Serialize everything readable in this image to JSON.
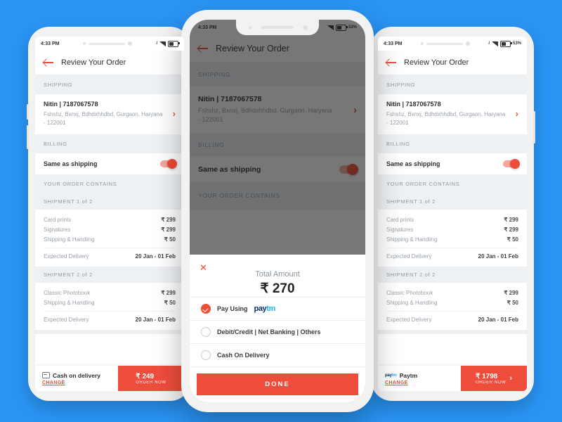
{
  "background_color": "#2a95f5",
  "accent_color": "#ef4d3c",
  "status_bar": {
    "time": "4:33 PM",
    "battery": "53%"
  },
  "header": {
    "title": "Review Your Order",
    "back_icon": "back-arrow-icon"
  },
  "sections": {
    "shipping_label": "SHIPPING",
    "billing_label": "BILLING",
    "order_label": "YOUR ORDER CONTAINS"
  },
  "address": {
    "name_phone": "Nitin | 7187067578",
    "line1": "Fshshz, Bxnxj, Bdhdxhhdbd, Gurgaon, Haryana",
    "line2": "- 122001",
    "chevron": "›"
  },
  "billing": {
    "same_as_shipping_label": "Same as shipping",
    "toggle_on": true
  },
  "shipments": [
    {
      "title": "SHIPMENT 1 of 2",
      "items": [
        {
          "name": "Card prints",
          "price": "₹ 299"
        },
        {
          "name": "Signatures",
          "price": "₹ 299"
        },
        {
          "name": "Shipping & Handling",
          "price": "₹ 50"
        }
      ],
      "delivery_label": "Expected Delivery",
      "delivery_value": "20 Jan - 01 Feb"
    },
    {
      "title": "SHIPMENT 2 of 2",
      "items": [
        {
          "name": "Classic Photobook",
          "price": "₹ 299"
        },
        {
          "name": "Shipping & Handling",
          "price": "₹ 50"
        }
      ],
      "delivery_label": "Expected Delivery",
      "delivery_value": "20 Jan - 01 Feb"
    }
  ],
  "bottom_bar_cod": {
    "method": "Cash on delivery",
    "method_icon": "wallet-icon",
    "change_label": "CHANGE",
    "amount": "₹ 249",
    "cta": "ORDER NOW"
  },
  "bottom_bar_paytm": {
    "method": "Paytm",
    "method_icon": "paytm-logo-icon",
    "change_label": "CHANGE",
    "amount": "₹ 1798",
    "cta": "ORDER NOW",
    "arrow": "›"
  },
  "modal": {
    "close_icon": "close-icon",
    "total_label": "Total Amount",
    "total_value": "₹ 270",
    "options": [
      {
        "label": "Pay Using",
        "brand_a": "pay",
        "brand_b": "tm",
        "selected": true
      },
      {
        "label": "Debit/Credit | Net Banking | Others",
        "selected": false
      },
      {
        "label": "Cash On Delivery",
        "selected": false
      }
    ],
    "done_label": "DONE"
  }
}
